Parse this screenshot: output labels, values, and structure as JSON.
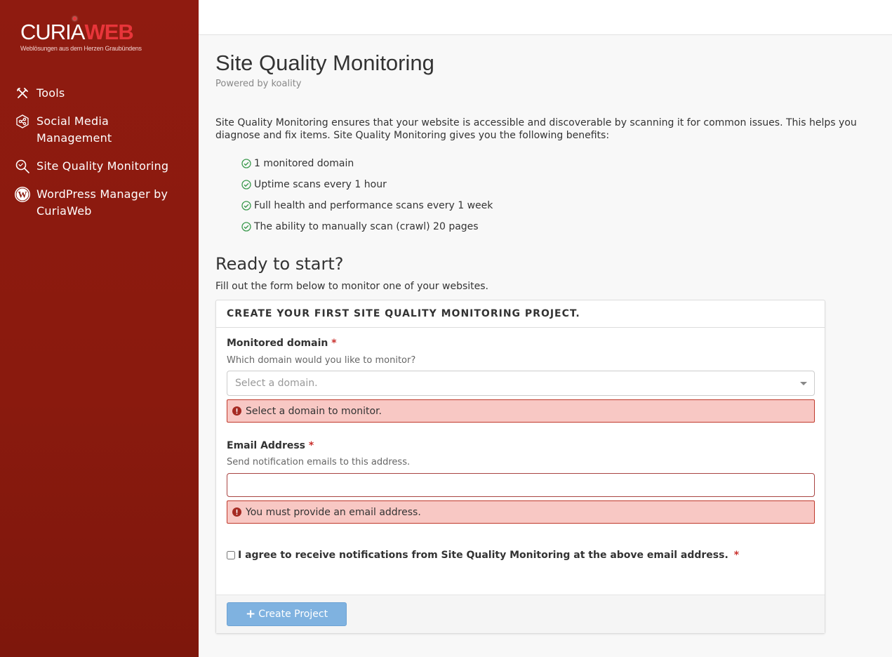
{
  "brand": {
    "logo_left": "CURIA",
    "logo_right": "WEB",
    "tagline": "Weblösungen aus dem Herzen Graubündens",
    "accent": "#e8353a",
    "sidebar_color": "#8a1a0e"
  },
  "sidebar": {
    "items": [
      {
        "label": "Tools",
        "icon": "tools-icon"
      },
      {
        "label": "Social Media Management",
        "icon": "social-media-icon"
      },
      {
        "label": "Site Quality Monitoring",
        "icon": "search-magnifier-icon"
      },
      {
        "label": "WordPress Manager by CuriaWeb",
        "icon": "wordpress-icon"
      }
    ]
  },
  "page": {
    "title": "Site Quality Monitoring",
    "powered_by": "Powered by koality",
    "intro": "Site Quality Monitoring ensures that your website is accessible and discoverable by scanning it for common issues. This helps you diagnose and fix items. Site Quality Monitoring gives you the following benefits:",
    "benefits": [
      "1 monitored domain",
      "Uptime scans every 1 hour",
      "Full health and performance scans every 1 week",
      "The ability to manually scan (crawl) 20 pages"
    ],
    "ready_heading": "Ready to start?",
    "ready_text": "Fill out the form below to monitor one of your websites."
  },
  "form": {
    "header": "CREATE YOUR FIRST SITE QUALITY MONITORING PROJECT.",
    "domain": {
      "label": "Monitored domain",
      "required_mark": "*",
      "help": "Which domain would you like to monitor?",
      "placeholder": "Select a domain.",
      "error": "Select a domain to monitor."
    },
    "email": {
      "label": "Email Address",
      "required_mark": "*",
      "help": "Send notification emails to this address.",
      "value": "",
      "error": "You must provide an email address."
    },
    "agree": {
      "label": "I agree to receive notifications from Site Quality Monitoring at the above email address.",
      "required_mark": "*",
      "checked": false
    },
    "submit_label": "Create Project"
  }
}
